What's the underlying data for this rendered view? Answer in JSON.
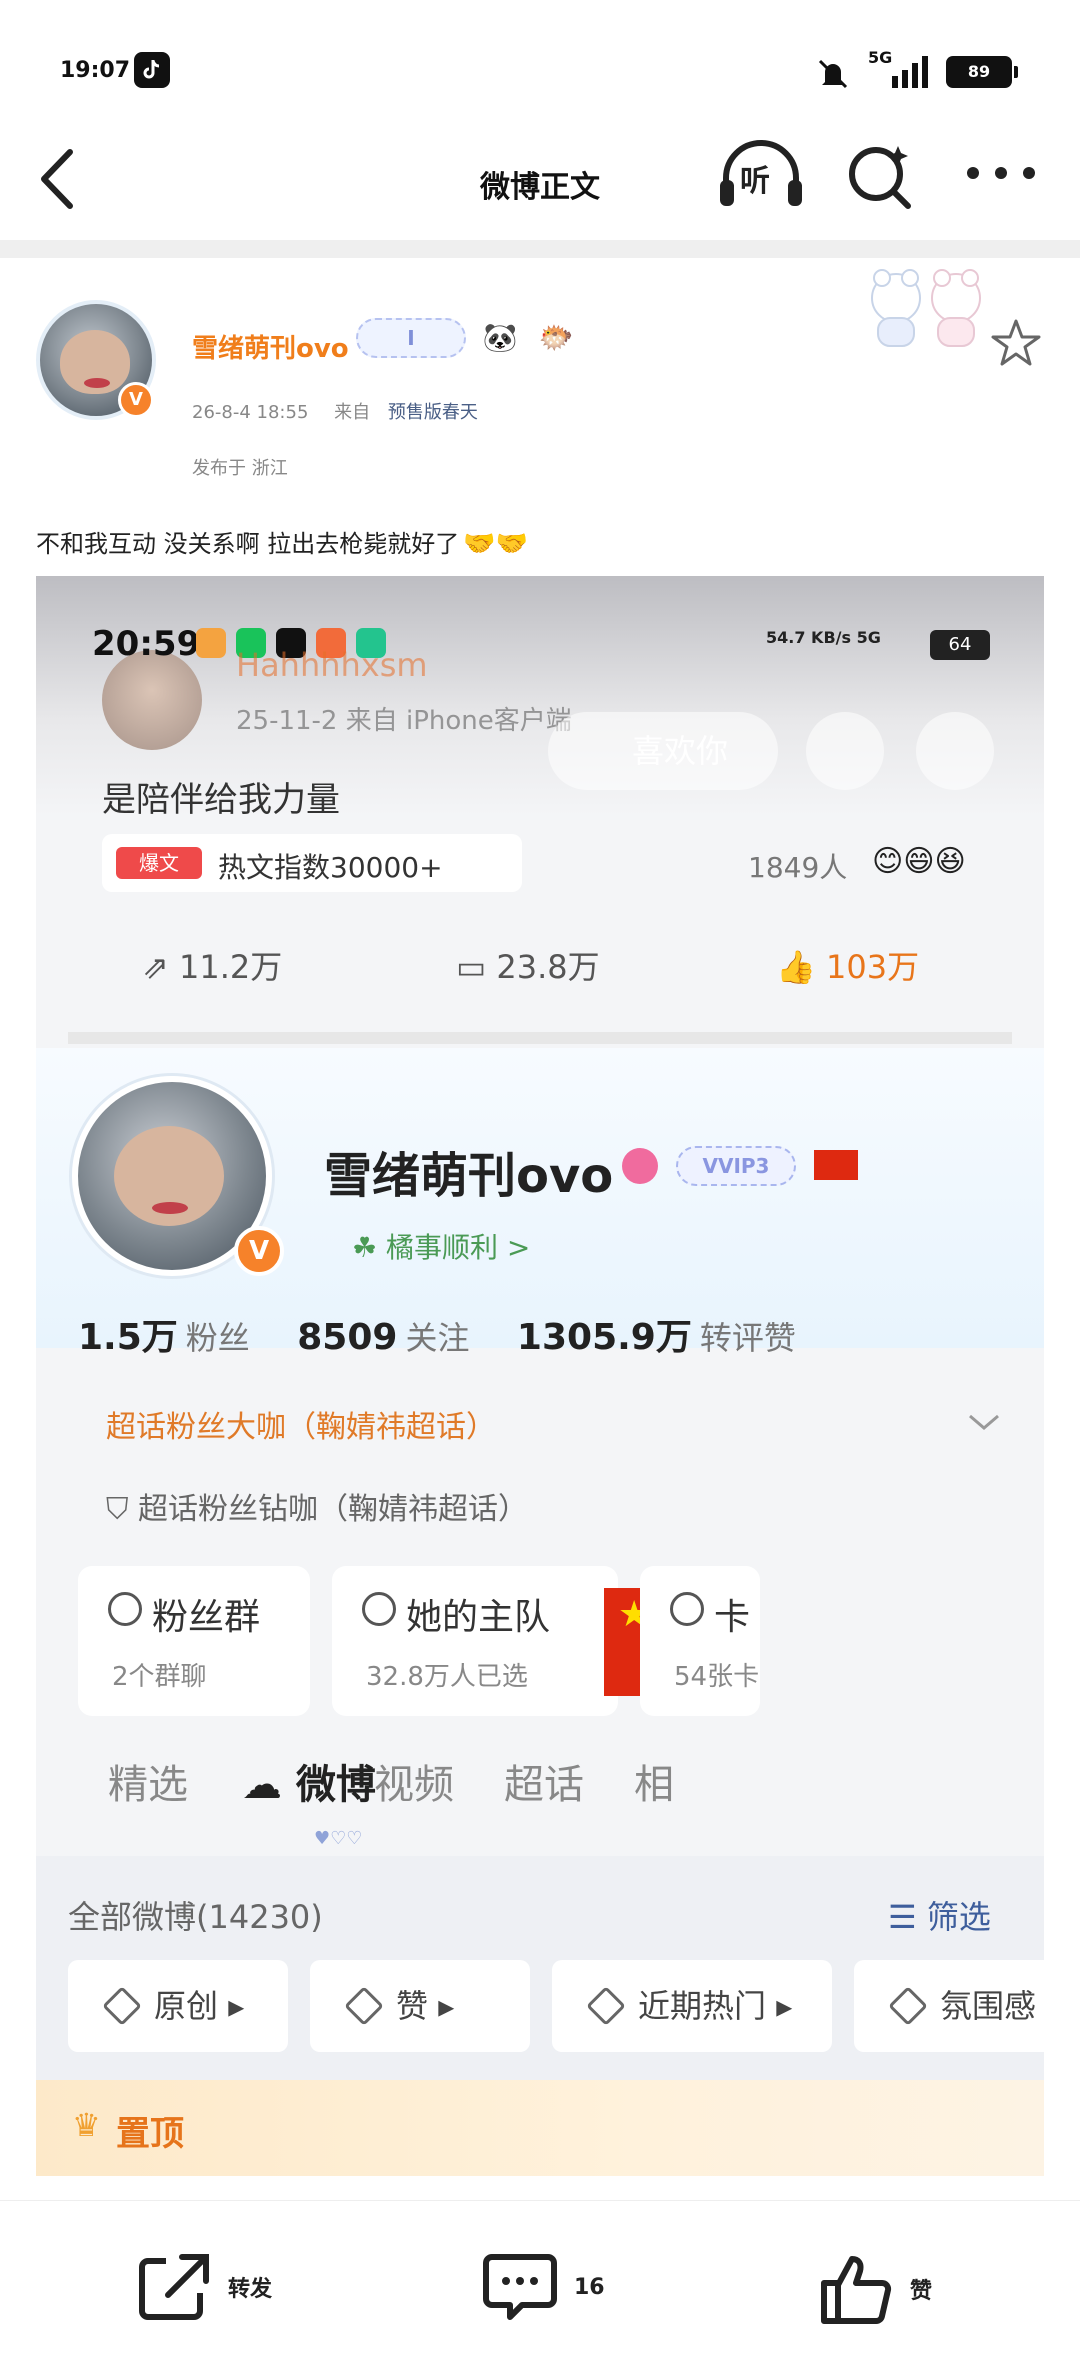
{
  "status_bar": {
    "time": "19:07",
    "network": "5G",
    "battery": "89"
  },
  "nav": {
    "title": "微博正文",
    "listen_label": "听"
  },
  "post": {
    "author": "雪绪萌刊ovo",
    "vip_label": "I",
    "date": "26-8-4 18:55",
    "source_prefix": "来自",
    "source": "预售版春天",
    "location": "发布于 浙江",
    "text": "不和我互动 没关系啊 拉出去枪毙就好了",
    "text_emoji": "🤝🤝"
  },
  "embedded": {
    "status_time": "20:59",
    "status_speed": "54.7 KB/s",
    "status_net": "5G",
    "status_battery": "64",
    "ghost_name": "Hahhhhxsm",
    "ghost_meta": "25-11-2  来自 iPhone客户端",
    "like_you": "喜欢你",
    "quote": "是陪伴给我力量",
    "hot_tag": "爆文",
    "hot_text": "热文指数30000+",
    "hot_count": "1849人",
    "reposts": "11.2万",
    "comments": "23.8万",
    "likes": "103万",
    "profile_name": "雪绪萌刊ovo",
    "profile_vip": "VVIP3",
    "profile_wish": "橘事顺利 >",
    "fans_num": "1.5万",
    "fans_label": "粉丝",
    "follow_num": "8509",
    "follow_label": "关注",
    "engage_num": "1305.9万",
    "engage_label": "转评赞",
    "fan_rank_1": "超话粉丝大咖（鞠婧祎超话）",
    "fan_rank_2": "超话粉丝钻咖（鞠婧祎超话）",
    "cards": [
      {
        "title": "粉丝群",
        "sub": "2个群聊"
      },
      {
        "title": "她的主队",
        "sub": "32.8万人已选"
      },
      {
        "title": "卡",
        "sub": "54张卡"
      }
    ],
    "tabs": [
      "精选",
      "微博",
      "视频",
      "超话",
      "相"
    ],
    "all_posts": "全部微博(14230)",
    "filter": "筛选",
    "chips": [
      "原创",
      "赞",
      "近期热门",
      "氛围感"
    ],
    "pinned": "置顶"
  },
  "toolbar": {
    "repost": "转发",
    "comment_count": "16",
    "like": "赞"
  }
}
